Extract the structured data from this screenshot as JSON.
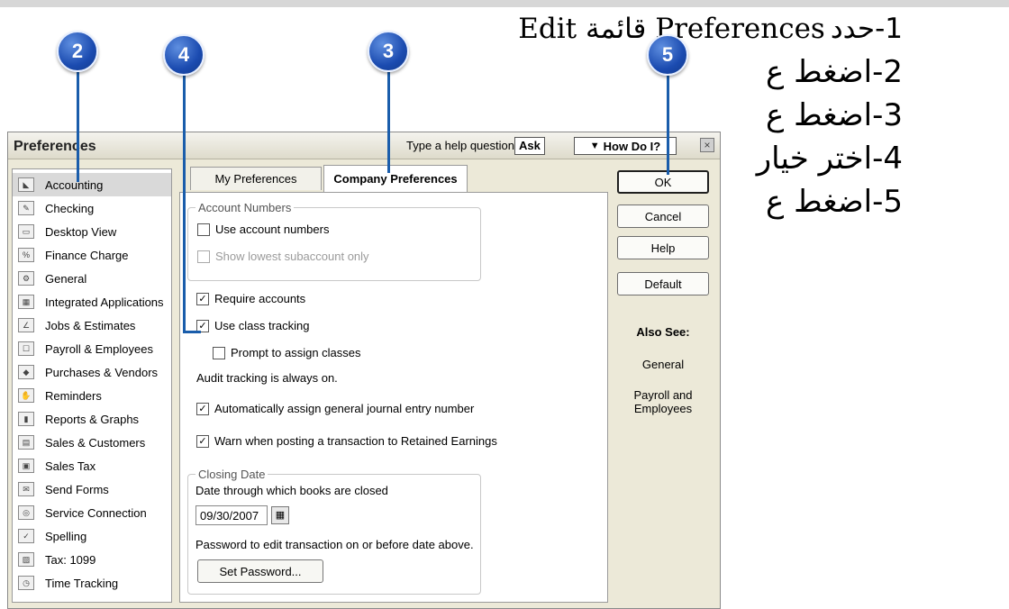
{
  "overlay": {
    "step1_prefix": "1-حدد",
    "step1_fragment": "Edit قائمة Preferences",
    "step2": "2-اضغط ع",
    "step3": "3-اضغط ع",
    "step4": "4-اختر خيار",
    "step5": "5-اضغط ع"
  },
  "callouts": [
    "2",
    "4",
    "3",
    "5"
  ],
  "dialog": {
    "title": "Preferences",
    "help_question": "Type a help question",
    "ask_label": "Ask",
    "how_do_i_label": "How Do I?",
    "close_glyph": "×"
  },
  "sidebar": {
    "items": [
      {
        "label": "Accounting",
        "icon": "accounting-icon",
        "selected": true
      },
      {
        "label": "Checking",
        "icon": "checking-icon"
      },
      {
        "label": "Desktop View",
        "icon": "desktop-view-icon"
      },
      {
        "label": "Finance Charge",
        "icon": "finance-charge-icon"
      },
      {
        "label": "General",
        "icon": "general-icon"
      },
      {
        "label": "Integrated Applications",
        "icon": "integrated-applications-icon"
      },
      {
        "label": "Jobs & Estimates",
        "icon": "jobs-estimates-icon"
      },
      {
        "label": "Payroll & Employees",
        "icon": "payroll-employees-icon"
      },
      {
        "label": "Purchases & Vendors",
        "icon": "purchases-vendors-icon"
      },
      {
        "label": "Reminders",
        "icon": "reminders-icon"
      },
      {
        "label": "Reports & Graphs",
        "icon": "reports-graphs-icon"
      },
      {
        "label": "Sales & Customers",
        "icon": "sales-customers-icon"
      },
      {
        "label": "Sales Tax",
        "icon": "sales-tax-icon"
      },
      {
        "label": "Send Forms",
        "icon": "send-forms-icon"
      },
      {
        "label": "Service Connection",
        "icon": "service-connection-icon"
      },
      {
        "label": "Spelling",
        "icon": "spelling-icon"
      },
      {
        "label": "Tax: 1099",
        "icon": "tax-1099-icon"
      },
      {
        "label": "Time Tracking",
        "icon": "time-tracking-icon"
      }
    ]
  },
  "tabs": {
    "my_prefs": "My Preferences",
    "company_prefs": "Company Preferences",
    "active": "Company Preferences"
  },
  "account_numbers": {
    "legend": "Account Numbers",
    "use_account_numbers": "Use account numbers",
    "use_account_numbers_checked": false,
    "show_lowest": "Show lowest subaccount only",
    "show_lowest_checked": false
  },
  "options": {
    "require_accounts": "Require accounts",
    "require_accounts_checked": true,
    "use_class_tracking": "Use class tracking",
    "use_class_tracking_checked": true,
    "prompt_assign_classes": "Prompt to assign classes",
    "prompt_assign_classes_checked": false,
    "audit_tracking": "Audit tracking is always on.",
    "auto_assign_journal": "Automatically assign general journal entry number",
    "auto_assign_journal_checked": true,
    "warn_retained": "Warn when posting a transaction to Retained Earnings",
    "warn_retained_checked": true
  },
  "closing_date": {
    "legend": "Closing Date",
    "label": "Date through which books are closed",
    "date_value": "09/30/2007",
    "password_label": "Password to edit transaction on or before date above.",
    "set_password_button": "Set Password..."
  },
  "buttons": {
    "ok": "OK",
    "cancel": "Cancel",
    "help": "Help",
    "default": "Default"
  },
  "also_see": {
    "heading": "Also See:",
    "links": [
      "General",
      "Payroll and Employees"
    ]
  },
  "colors": {
    "callout_blue": "#1b4bb0",
    "line_blue": "#1a5dab",
    "dialog_bg": "#ece9d8",
    "selected_item": "#d9d9d9"
  }
}
